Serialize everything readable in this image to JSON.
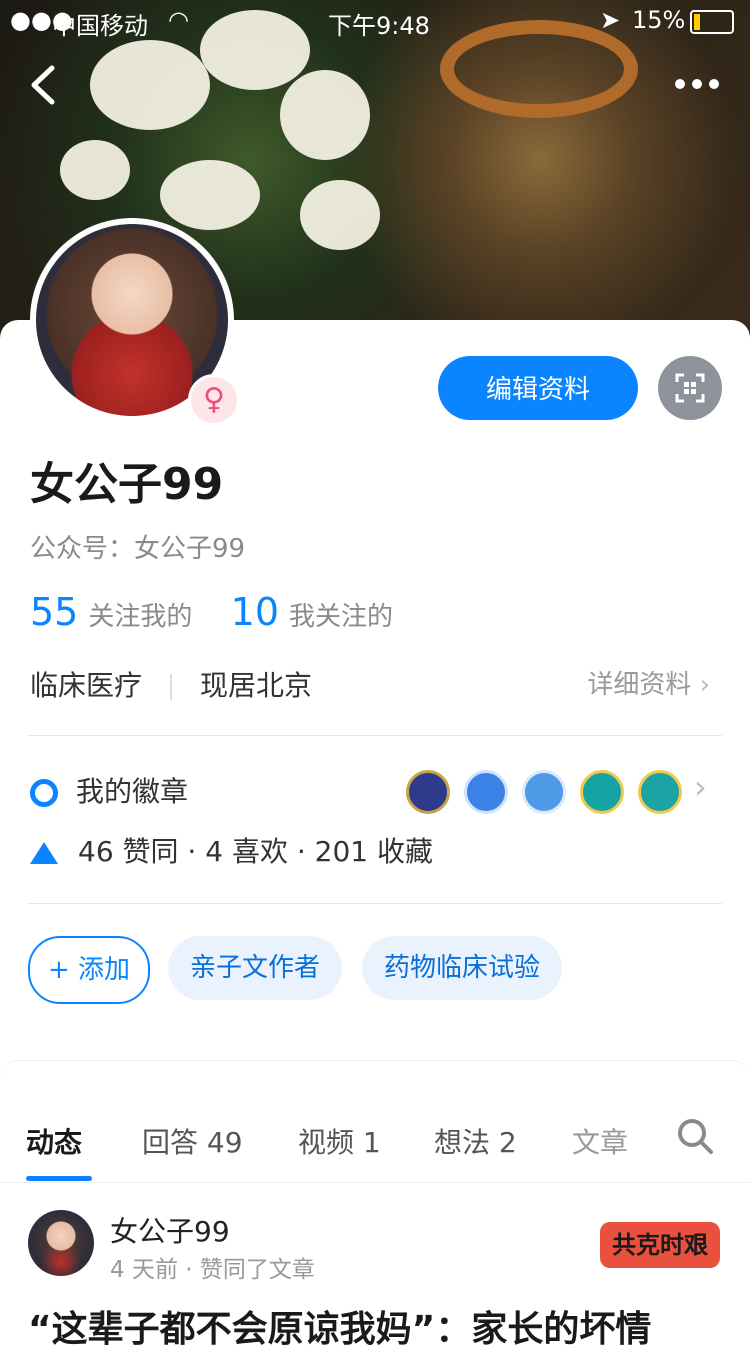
{
  "status": {
    "carrier": "中国移动",
    "time": "下午9:48",
    "battery": "15%"
  },
  "nav": {
    "back_icon": "chevron-left-icon",
    "more_icon": "more-icon"
  },
  "profile": {
    "name": "女公子99",
    "account_label": "公众号：",
    "account_name": "女公子99",
    "gender_icon": "♀",
    "edit_button": "编辑资料",
    "qr_icon": "qr-code-icon",
    "followers_count": "55",
    "followers_label": "关注我的",
    "following_count": "10",
    "following_label": "我关注的",
    "industry": "临床医疗",
    "location": "现居北京",
    "detail_link": "详细资料",
    "badges_label": "我的徽章",
    "stats_text": "46 赞同 · 4 喜欢 · 201 收藏"
  },
  "tags": {
    "add_label": "+ 添加",
    "items": [
      "亲子文作者",
      "药物临床试验"
    ]
  },
  "tabs": [
    "动态",
    "回答 49",
    "视频 1",
    "想法 2",
    "文章"
  ],
  "feed": {
    "author": "女公子99",
    "meta": "4 天前 · 赞同了文章",
    "logo_text": "共克时艰",
    "title": "“这辈子都不会原谅我妈”：家长的坏情"
  },
  "colors": {
    "accent": "#0a84ff",
    "chip_bg": "#eaf3fd"
  }
}
